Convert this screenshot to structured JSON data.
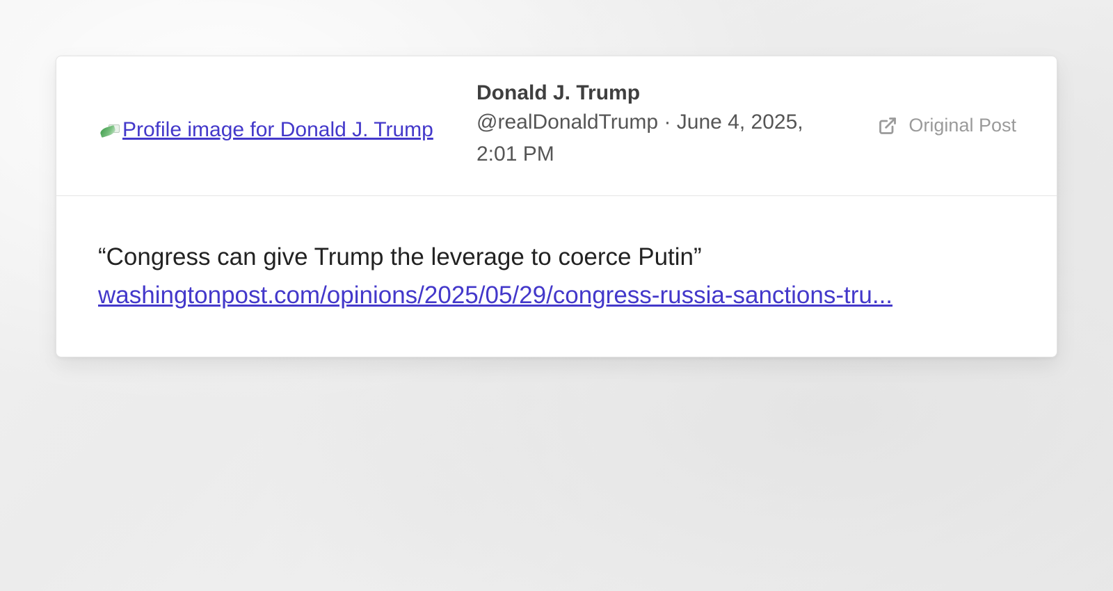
{
  "post": {
    "avatar_alt": "Profile image for Donald J. Trump",
    "author_name": "Donald J. Trump",
    "handle_date": "@realDonaldTrump · June 4, 2025,",
    "time": "2:01 PM",
    "original_post_label": "Original Post",
    "quote_text": "“Congress can give Trump the leverage to coerce Putin”",
    "link_text": "washingtonpost.com/opinions/2025/05/29/congress-russia-sanctions-tru..."
  },
  "icons": {
    "external_link": "external-link-icon",
    "avatar_placeholder": "broken-image-icon"
  },
  "colors": {
    "link": "#4338ca",
    "muted": "#9a9a9a",
    "text": "#222222",
    "card_bg": "#ffffff"
  }
}
